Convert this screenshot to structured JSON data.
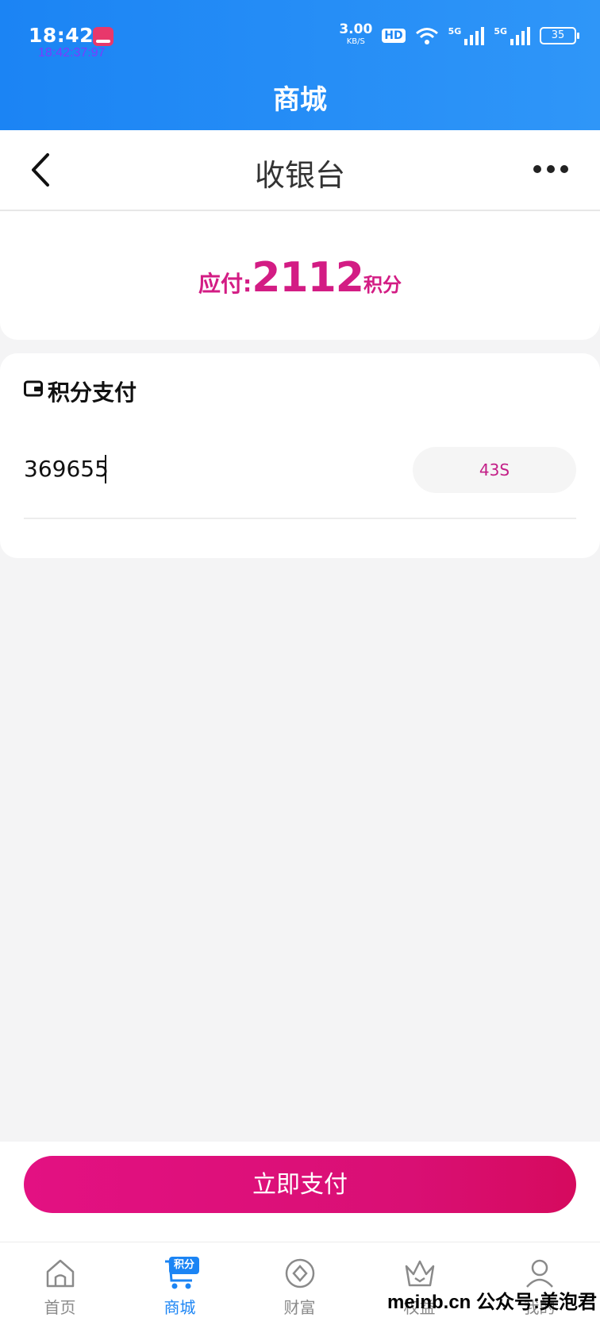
{
  "status_bar": {
    "time": "18:42",
    "clock_overlay": "18:42:37:97",
    "net_speed_value": "3.00",
    "net_speed_unit": "KB/S",
    "hd_label": "HD",
    "signal_label_1": "5G",
    "signal_label_2": "5G",
    "battery": "35"
  },
  "header": {
    "title": "商城"
  },
  "nav": {
    "title": "收银台"
  },
  "amount": {
    "label": "应付:",
    "value": "2112",
    "unit": "积分"
  },
  "payment": {
    "title": "积分支付",
    "code_value": "369655",
    "countdown": "43S"
  },
  "action": {
    "pay_label": "立即支付"
  },
  "tabs": [
    {
      "label": "首页",
      "icon": "home-icon"
    },
    {
      "label": "商城",
      "icon": "cart-icon",
      "badge": "积分",
      "active": true
    },
    {
      "label": "财富",
      "icon": "coin-icon"
    },
    {
      "label": "权益",
      "icon": "crown-icon"
    },
    {
      "label": "我的",
      "icon": "user-icon"
    }
  ],
  "watermark": "meinb.cn  公众号:美泡君",
  "colors": {
    "brand_blue": "#1b84f4",
    "accent_pink": "#d31c84"
  }
}
